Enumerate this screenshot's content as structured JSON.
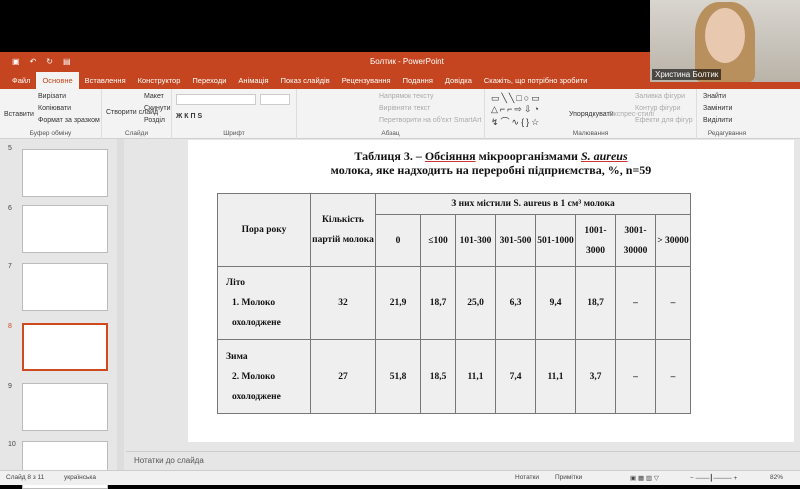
{
  "window": {
    "title": "Болтик - PowerPoint"
  },
  "tabs": [
    "Файл",
    "Основне",
    "Вставлення",
    "Конструктор",
    "Переходи",
    "Анімація",
    "Показ слайдів",
    "Рецензування",
    "Подання",
    "Довідка",
    "Скажіть, що потрібно зробити"
  ],
  "ribbon": {
    "clipboard": {
      "paste": "Вставити",
      "cut": "Вирізати",
      "copy": "Копіювати",
      "format": "Формат за зразком",
      "label": "Буфер обміну"
    },
    "slides": {
      "new": "Створити слайд",
      "layout": "Макет",
      "reset": "Скинути",
      "section": "Розділ",
      "label": "Слайди"
    },
    "font": {
      "label": "Шрифт"
    },
    "paragraph": {
      "dir": "Напрямок тексту",
      "align": "Вирівняти текст",
      "smartart": "Перетворити на об'єкт SmartArt",
      "label": "Абзац"
    },
    "drawing": {
      "arrange": "Упорядкувати",
      "styles": "Експрес-стилі",
      "fill": "Заливка фігури",
      "outline": "Контур фігури",
      "effects": "Ефекти для фігур",
      "label": "Малювання"
    },
    "editing": {
      "find": "Знайти",
      "replace": "Замінити",
      "select": "Виділити",
      "label": "Редагування"
    }
  },
  "webcam": {
    "name": "Христина Болтик"
  },
  "thumbnails": [
    "5",
    "6",
    "7",
    "8",
    "9",
    "10"
  ],
  "slide": {
    "title_a": "Таблиця 3. – ",
    "title_b": "Обсіяння",
    "title_c": " мікроорганізмами ",
    "title_d": "S. aureus",
    "title_e": " молока, яке надходить на переробні підприємства, %, n=59",
    "table": {
      "h_season": "Пора року",
      "h_count": "Кількість партій молока",
      "h_group": "З них містили S. aureus в 1 см³ молока",
      "cols": [
        "0",
        "≤100",
        "101-300",
        "301-500",
        "501-1000",
        "1001-3000",
        "3001-30000",
        "> 30000"
      ],
      "rows": [
        {
          "season": "Літо",
          "item": "1. Молоко охолоджене",
          "count": "32",
          "values": [
            "21,9",
            "18,7",
            "25,0",
            "6,3",
            "9,4",
            "18,7",
            "–",
            "–"
          ]
        },
        {
          "season": "Зима",
          "item": "2. Молоко охолоджене",
          "count": "27",
          "values": [
            "51,8",
            "18,5",
            "11,1",
            "7,4",
            "11,1",
            "3,7",
            "–",
            "–"
          ]
        }
      ]
    }
  },
  "notes": "Нотатки до слайда",
  "status": {
    "slide": "Слайд 8 з 11",
    "lang": "українська",
    "notes": "Нотатки",
    "comments": "Примітки",
    "zoom": "82%"
  }
}
